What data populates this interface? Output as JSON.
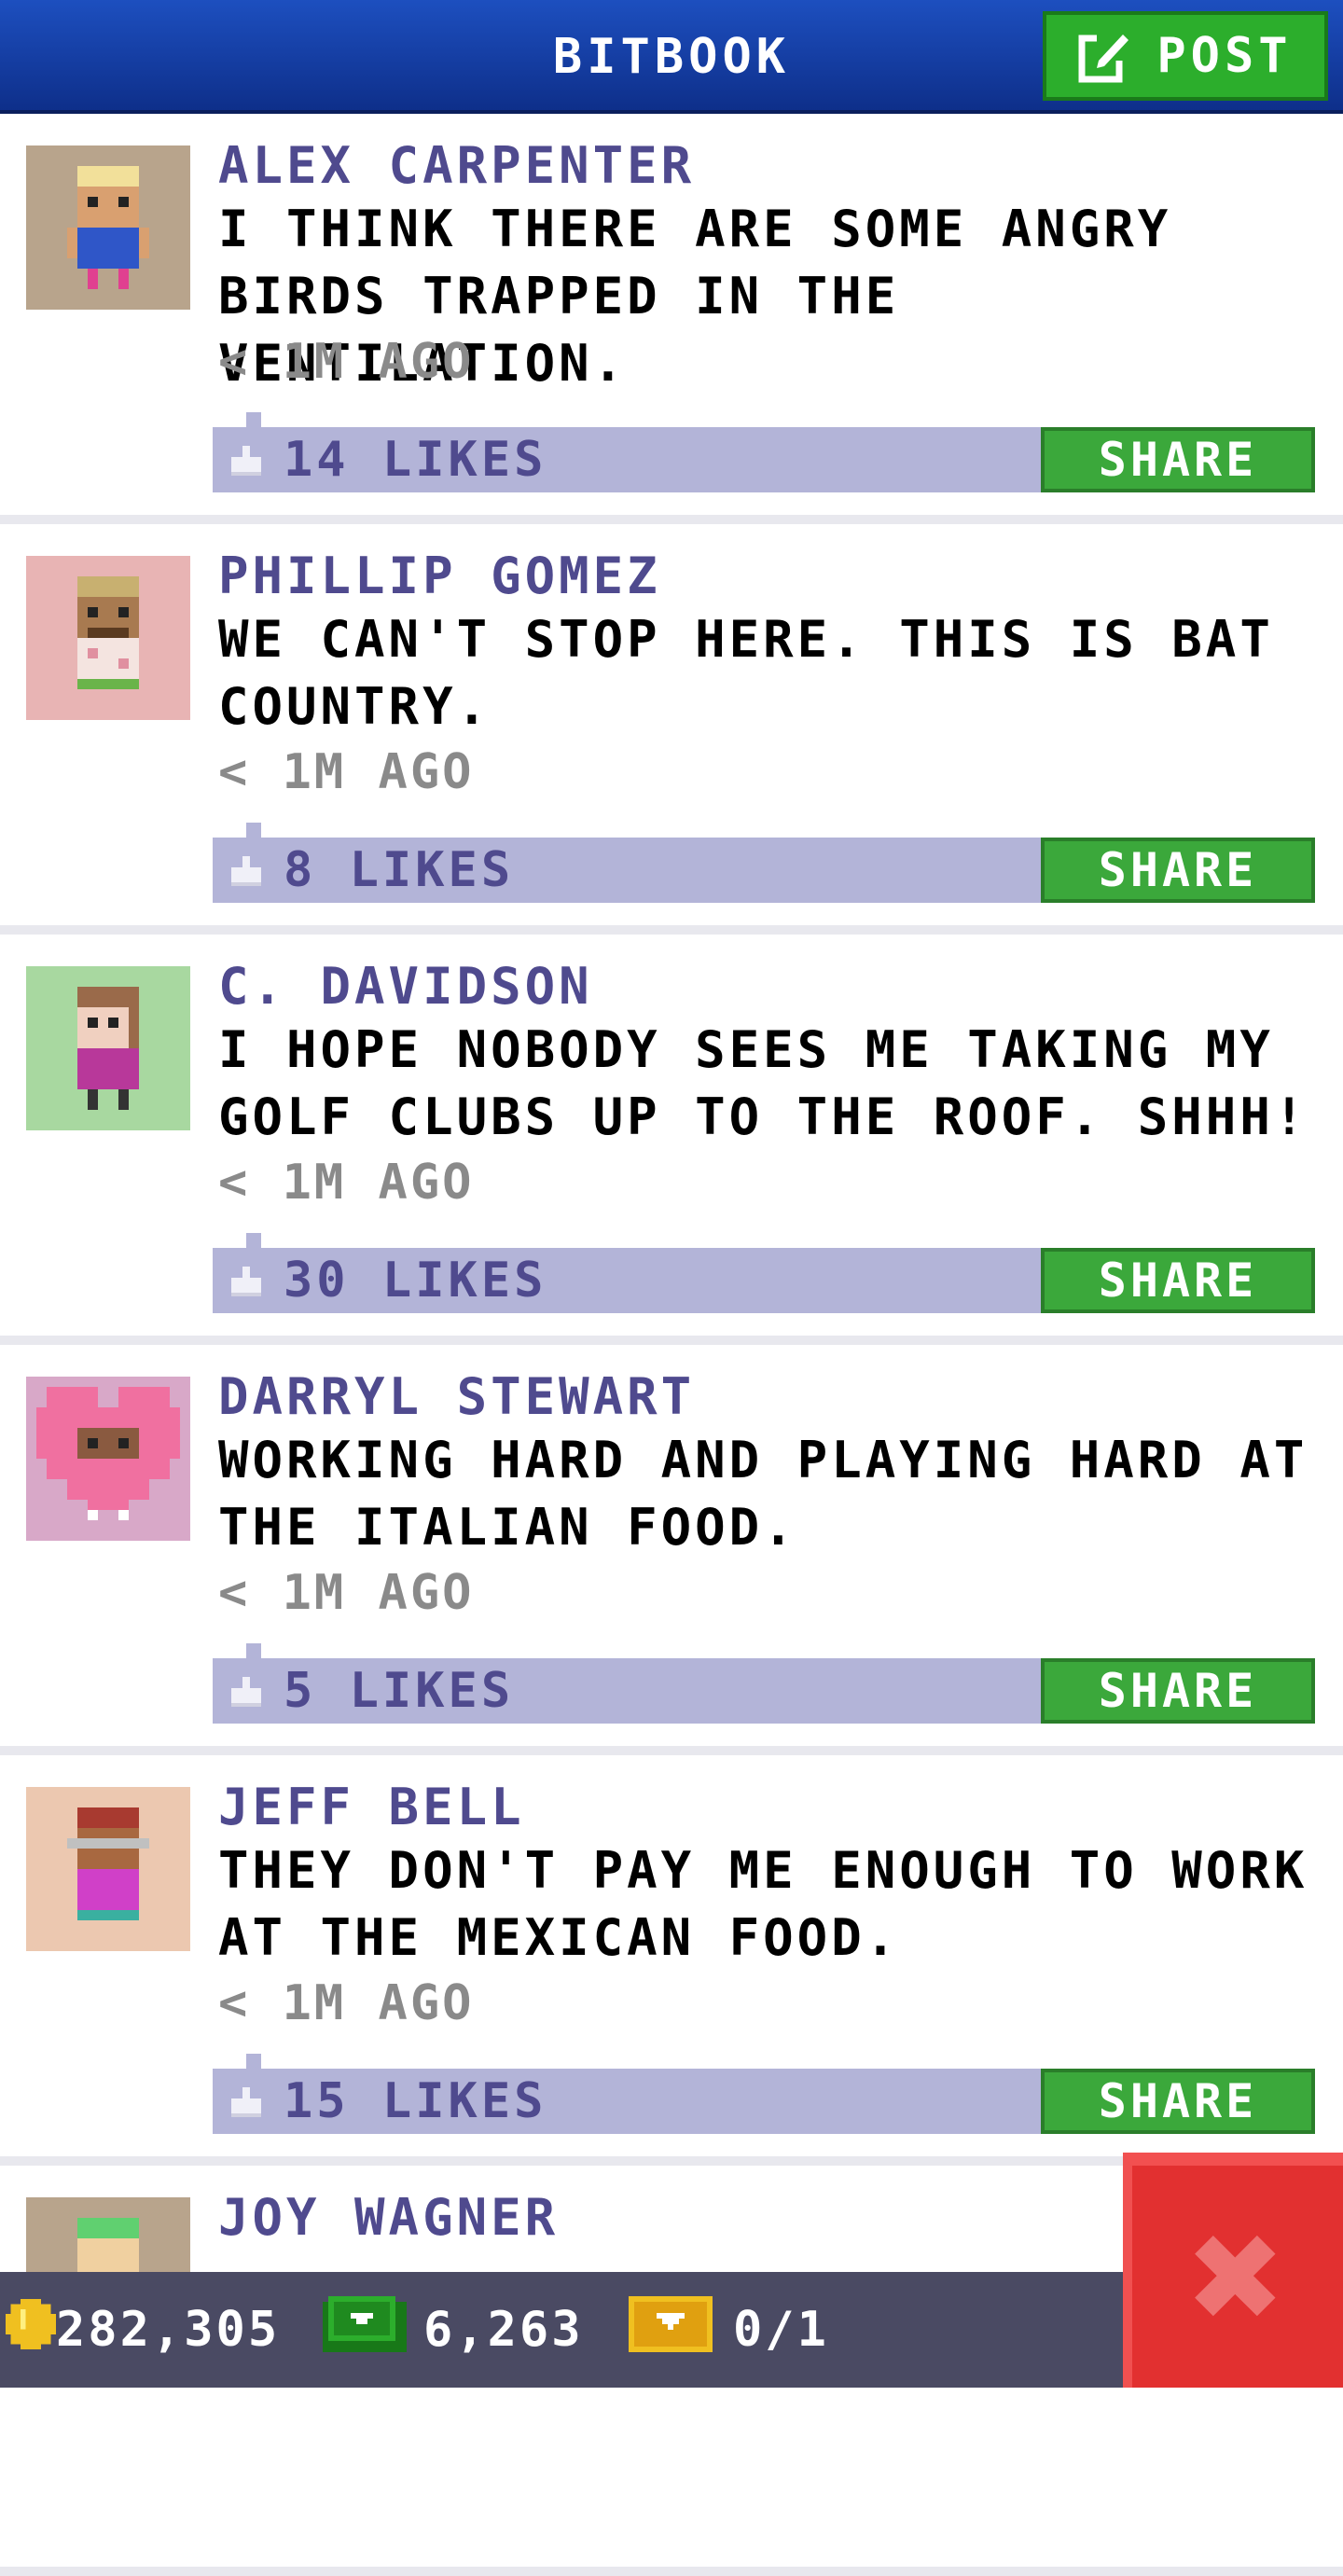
{
  "header": {
    "title": "BITBOOK",
    "post_label": "POST",
    "post_icon": "compose-icon"
  },
  "posts": [
    {
      "author": "ALEX CARPENTER",
      "text": "I THINK THERE ARE SOME ANGRY BIRDS TRAPPED IN THE VENTILATION.",
      "time": "< 1M AGO",
      "likes": "14 LIKES",
      "share_label": "SHARE",
      "avatar_bg": "#b8a48c",
      "skin": "#d9a070",
      "hair": "#f2e09a",
      "shirt": "#2f56c8",
      "legs": "#e04090"
    },
    {
      "author": "PHILLIP GOMEZ",
      "text": "WE CAN'T STOP HERE. THIS IS BAT COUNTRY.",
      "time": "< 1M AGO",
      "likes": "8 LIKES",
      "share_label": "SHARE",
      "avatar_bg": "#e8b4b4",
      "skin": "#a87a50",
      "hair": "#c8b070",
      "shirt": "#f4e4e0",
      "legs": "#6ab44a"
    },
    {
      "author": "C. DAVIDSON",
      "text": "I HOPE NOBODY SEES ME TAKING MY GOLF CLUBS UP TO THE ROOF. SHHH!",
      "time": "< 1M AGO",
      "likes": "30 LIKES",
      "share_label": "SHARE",
      "avatar_bg": "#a8d8a0",
      "skin": "#f0d0c0",
      "hair": "#9a6a4a",
      "shirt": "#b8389a",
      "legs": "#333333"
    },
    {
      "author": "DARRYL STEWART",
      "text": "WORKING HARD AND PLAYING HARD AT THE ITALIAN FOOD.",
      "time": "< 1M AGO",
      "likes": "5 LIKES",
      "share_label": "SHARE",
      "avatar_bg": "#d8a8c8",
      "skin": "#8a5a40",
      "hair": "#f070a0",
      "shirt": "#f070a0",
      "legs": "#ffffff"
    },
    {
      "author": "JEFF BELL",
      "text": "THEY DON'T PAY ME ENOUGH TO WORK AT THE MEXICAN FOOD.",
      "time": "< 1M AGO",
      "likes": "15 LIKES",
      "share_label": "SHARE",
      "avatar_bg": "#ecc8b0",
      "skin": "#a86840",
      "hair": "#a83a30",
      "shirt": "#d040c8",
      "legs": "#3ab0a0"
    }
  ],
  "partial_post": {
    "author": "JOY WAGNER",
    "avatar_bg": "#b8a48c",
    "hair": "#60d070"
  },
  "status_bar": {
    "coins": "282,305",
    "bux": "6,263",
    "tickets": "0/1",
    "coin_icon": "coin-icon",
    "bux_icon": "bux-icon",
    "ticket_icon": "ticket-icon"
  },
  "close_label": "✖"
}
